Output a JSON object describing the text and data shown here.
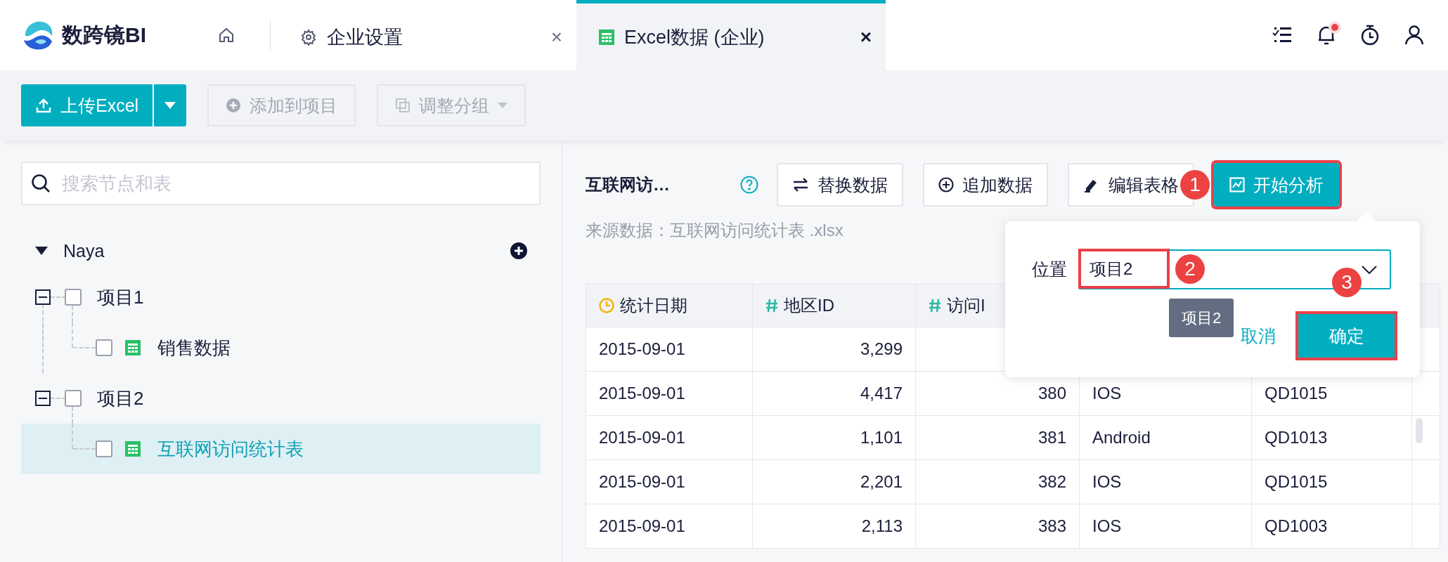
{
  "header": {
    "logo_text": "数跨镜BI",
    "tabs": [
      {
        "label": "企业设置",
        "kind": "settings",
        "close": "×",
        "selected": false
      },
      {
        "label": "Excel数据 (企业)",
        "kind": "sheet",
        "close": "×",
        "selected": true
      }
    ],
    "notification_dot": true
  },
  "toolbar": {
    "buttons": [
      {
        "label": "上传Excel",
        "kind": "upload",
        "disabled": false
      },
      {
        "label": "添加到项目",
        "kind": "add",
        "disabled": true
      },
      {
        "label": "调整分组",
        "kind": "group",
        "disabled": true
      }
    ]
  },
  "sidebar": {
    "search": {
      "placeholder": "搜索节点和表"
    },
    "tree": {
      "label": "Naya",
      "expanded": true,
      "children": [
        {
          "label": "项目1",
          "kind": "folder",
          "expanded": true,
          "checked": false,
          "selected": false,
          "children": [
            {
              "label": "销售数据",
              "kind": "table",
              "checked": false,
              "selected": false
            }
          ]
        },
        {
          "label": "项目2",
          "kind": "folder",
          "expanded": true,
          "checked": false,
          "selected": false,
          "children": [
            {
              "label": "互联网访问统计表",
              "kind": "table",
              "checked": false,
              "selected": true
            }
          ]
        }
      ]
    }
  },
  "content": {
    "title": "互联网访…",
    "actions": [
      {
        "label": "替换数据",
        "kind": "replace",
        "highlighted": false
      },
      {
        "label": "追加数据",
        "kind": "append",
        "highlighted": false
      },
      {
        "label": "编辑表格",
        "kind": "edit",
        "highlighted": false
      },
      {
        "label": "开始分析",
        "kind": "analyze",
        "highlighted": true,
        "step": "1"
      }
    ],
    "source": "来源数据：互联网访问统计表 .xlsx",
    "table": {
      "columns": [
        {
          "label": "统计日期",
          "kind": "date"
        },
        {
          "label": "地区ID",
          "kind": "number"
        },
        {
          "label": "访问I",
          "kind": "number"
        }
      ],
      "rows": [
        [
          "2015-09-01",
          "3,299"
        ],
        [
          "2015-09-01",
          "4,417",
          "380",
          "IOS",
          "QD1015"
        ],
        [
          "2015-09-01",
          "1,101",
          "381",
          "Android",
          "QD1013"
        ],
        [
          "2015-09-01",
          "2,201",
          "382",
          "IOS",
          "QD1015"
        ],
        [
          "2015-09-01",
          "2,113",
          "383",
          "IOS",
          "QD1003"
        ]
      ]
    }
  },
  "popup": {
    "label": "位置",
    "value": "项目2",
    "value_highlighted": true,
    "step": "2",
    "tooltip": "项目2",
    "buttons": [
      {
        "label": "取消",
        "kind": "link",
        "highlighted": false
      },
      {
        "label": "确定",
        "kind": "primary",
        "highlighted": true,
        "step": "3"
      }
    ]
  }
}
